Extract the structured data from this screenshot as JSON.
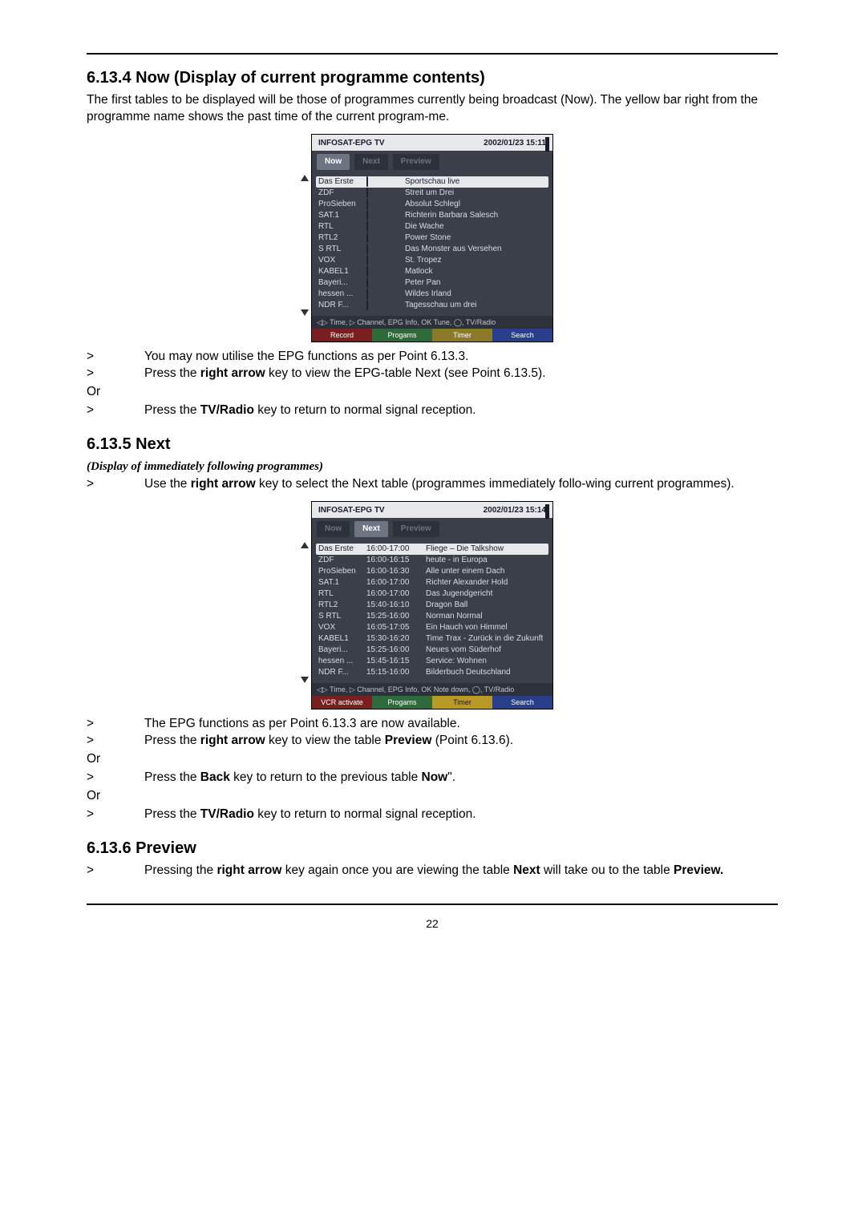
{
  "section_6134_title": "6.13.4 Now (Display of current programme contents)",
  "section_6134_intro": "The first tables to be displayed will be those of programmes currently being broadcast (Now). The yellow bar right from the programme name shows the past time of the current program-me.",
  "section_6134_bullets": [
    {
      "pre": "You may now utilise the EPG functions as per Point 6.13.3."
    },
    {
      "pre": "Press the ",
      "bold": "right arrow",
      "post": " key to view the EPG-table Next (see Point 6.13.5)."
    }
  ],
  "or_label": "Or",
  "section_6134_bullet3_pre": "Press the ",
  "section_6134_bullet3_bold": "TV/Radio",
  "section_6134_bullet3_post": " key to return to normal signal reception.",
  "section_6135_title": "6.13.5 Next",
  "section_6135_sub": "(Display of  immediately following programmes)",
  "section_6135_intro_pre": "Use the ",
  "section_6135_intro_bold": "right arrow",
  "section_6135_intro_post": " key to select the Next table (programmes immediately follo-wing current programmes).",
  "section_6135_bullets_1": "The EPG functions as per Point 6.13.3 are now available.",
  "section_6135_bullets_2_pre": "Press the ",
  "section_6135_bullets_2_bold1": "right arrow",
  "section_6135_bullets_2_mid": " key to view the table ",
  "section_6135_bullets_2_bold2": "Preview",
  "section_6135_bullets_2_post": " (Point 6.13.6).",
  "section_6135_bullets_3_pre": "Press the ",
  "section_6135_bullets_3_bold1": "Back",
  "section_6135_bullets_3_mid": " key to return to the previous table ",
  "section_6135_bullets_3_bold2": "Now",
  "section_6135_bullets_3_post": "\".",
  "section_6135_bullets_4_pre": "Press the ",
  "section_6135_bullets_4_bold": "TV/Radio",
  "section_6135_bullets_4_post": " key to return to normal signal reception.",
  "section_6136_title": "6.13.6 Preview",
  "section_6136_pre": "Pressing the ",
  "section_6136_bold1": "right arrow",
  "section_6136_mid": " key again once you are viewing the table ",
  "section_6136_bold2": "Next",
  "section_6136_mid2": " will take ou to the table ",
  "section_6136_bold3": "Preview.",
  "page_num": "22",
  "epg1": {
    "title_left": "INFOSAT-EPG TV",
    "title_right": "2002/01/23  15:11",
    "tabs": [
      "Now",
      "Next",
      "Preview"
    ],
    "active_tab": 0,
    "rows": [
      {
        "ch": "Das Erste",
        "pg": "Sportschau live",
        "fill": 60,
        "sel": true
      },
      {
        "ch": "ZDF",
        "pg": "Streit um Drei",
        "fill": 25
      },
      {
        "ch": "ProSieben",
        "pg": "Absolut Schlegl",
        "fill": 35
      },
      {
        "ch": "SAT.1",
        "pg": "Richterin Barbara Salesch",
        "fill": 20
      },
      {
        "ch": "RTL",
        "pg": "Die Wache",
        "fill": 30
      },
      {
        "ch": "RTL2",
        "pg": "Power Stone",
        "fill": 25
      },
      {
        "ch": "S RTL",
        "pg": "Das Monster aus Versehen",
        "fill": 55
      },
      {
        "ch": "VOX",
        "pg": "St. Tropez",
        "fill": 30
      },
      {
        "ch": "KABEL1",
        "pg": "Matlock",
        "fill": 60
      },
      {
        "ch": "Bayeri...",
        "pg": "Peter Pan",
        "fill": 25
      },
      {
        "ch": "hessen ...",
        "pg": "Wildes Irland",
        "fill": 30
      },
      {
        "ch": "NDR F...",
        "pg": "Tagesschau um drei",
        "fill": 40
      }
    ],
    "footline": "◁▷ Time, ▷ Channel, EPG Info, OK Tune, ◯, TV/Radio",
    "footbtns": [
      "Record",
      "Progams",
      "Timer",
      "Search"
    ]
  },
  "epg2": {
    "title_left": "INFOSAT-EPG TV",
    "title_right": "2002/01/23  15:14",
    "tabs": [
      "Now",
      "Next",
      "Preview"
    ],
    "active_tab": 1,
    "rows": [
      {
        "ch": "Das Erste",
        "tm": "16:00-17:00",
        "pg": "Fliege – Die Talkshow",
        "sel": true
      },
      {
        "ch": "ZDF",
        "tm": "16:00-16:15",
        "pg": "heute - in Europa"
      },
      {
        "ch": "ProSieben",
        "tm": "16:00-16:30",
        "pg": "Alle unter einem Dach"
      },
      {
        "ch": "SAT.1",
        "tm": "16:00-17:00",
        "pg": "Richter Alexander Hold"
      },
      {
        "ch": "RTL",
        "tm": "16:00-17:00",
        "pg": "Das Jugendgericht"
      },
      {
        "ch": "RTL2",
        "tm": "15:40-16:10",
        "pg": "Dragon Ball"
      },
      {
        "ch": "S RTL",
        "tm": "15:25-16:00",
        "pg": "Norman Normal"
      },
      {
        "ch": "VOX",
        "tm": "16:05-17:05",
        "pg": "Ein Hauch von Himmel"
      },
      {
        "ch": "KABEL1",
        "tm": "15:30-16:20",
        "pg": "Time Trax - Zurück in die Zukunft"
      },
      {
        "ch": "Bayeri...",
        "tm": "15:25-16:00",
        "pg": "Neues vom Süderhof"
      },
      {
        "ch": "hessen ...",
        "tm": "15:45-16:15",
        "pg": "Service: Wohnen"
      },
      {
        "ch": "NDR F...",
        "tm": "15:15-16:00",
        "pg": "Bilderbuch Deutschland"
      }
    ],
    "footline": "◁▷ Time, ▷ Channel, EPG Info, OK Note down, ◯, TV/Radio",
    "footbtns": [
      "VCR activate",
      "Progams",
      "Timer",
      "Search"
    ]
  }
}
